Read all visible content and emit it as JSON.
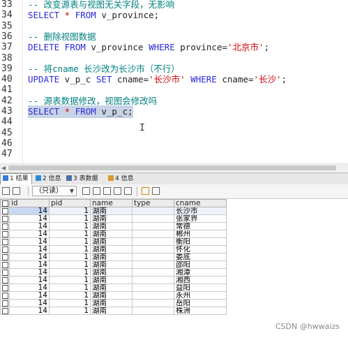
{
  "editor": {
    "lines": [
      {
        "num": "33",
        "parts": [
          {
            "t": "-- 改变源表与视图无关字段，无影响",
            "c": "cmt"
          }
        ]
      },
      {
        "num": "34",
        "parts": [
          {
            "t": "SELECT",
            "c": "kw"
          },
          {
            "t": " * ",
            "c": "str"
          },
          {
            "t": "FROM",
            "c": "kw"
          },
          {
            "t": " v_province;",
            "c": "txt"
          }
        ]
      },
      {
        "num": "35",
        "parts": []
      },
      {
        "num": "36",
        "parts": [
          {
            "t": "-- 删除视图数据",
            "c": "cmt"
          }
        ]
      },
      {
        "num": "37",
        "parts": [
          {
            "t": "DELETE FROM",
            "c": "kw"
          },
          {
            "t": " v_province ",
            "c": "txt"
          },
          {
            "t": "WHERE",
            "c": "kw"
          },
          {
            "t": " province=",
            "c": "txt"
          },
          {
            "t": "'北京市'",
            "c": "str"
          },
          {
            "t": ";",
            "c": "txt"
          }
        ]
      },
      {
        "num": "38",
        "parts": []
      },
      {
        "num": "39",
        "parts": [
          {
            "t": "-- 将cname 长沙改为长沙市（不行）",
            "c": "cmt"
          }
        ]
      },
      {
        "num": "40",
        "parts": [
          {
            "t": "UPDATE",
            "c": "kw"
          },
          {
            "t": " v_p_c ",
            "c": "txt"
          },
          {
            "t": "SET",
            "c": "kw"
          },
          {
            "t": " cname=",
            "c": "txt"
          },
          {
            "t": "'长沙市'",
            "c": "str"
          },
          {
            "t": " ",
            "c": "txt"
          },
          {
            "t": "WHERE",
            "c": "kw"
          },
          {
            "t": " cname=",
            "c": "txt"
          },
          {
            "t": "'长沙'",
            "c": "str"
          },
          {
            "t": ";",
            "c": "txt"
          }
        ]
      },
      {
        "num": "41",
        "parts": []
      },
      {
        "num": "42",
        "parts": [
          {
            "t": "-- 源表数据修改，视图会修改吗",
            "c": "cmt"
          }
        ]
      },
      {
        "num": "43",
        "selected": true,
        "parts": [
          {
            "t": "SELECT",
            "c": "kw"
          },
          {
            "t": " * ",
            "c": "str"
          },
          {
            "t": "FROM",
            "c": "kw"
          },
          {
            "t": " v_p_c;",
            "c": "txt"
          }
        ]
      },
      {
        "num": "44",
        "parts": []
      },
      {
        "num": "45",
        "parts": []
      },
      {
        "num": "46",
        "parts": []
      },
      {
        "num": "47",
        "parts": []
      }
    ],
    "cursor_glyph": "I"
  },
  "tabs": [
    {
      "label": "1 结果",
      "active": true,
      "icon": "result-grid-icon",
      "color": "#3a7bd5"
    },
    {
      "label": "2 信息",
      "active": false,
      "icon": "info-icon",
      "color": "#2e8bd8"
    },
    {
      "label": "3 表数据",
      "active": false,
      "icon": "table-data-icon",
      "color": "#4a6fa5"
    },
    {
      "label": "4 信息",
      "active": false,
      "icon": "info-icon",
      "color": "#d89a2e"
    }
  ],
  "toolbar": {
    "mode_select": "（只读）"
  },
  "grid": {
    "columns": [
      "id",
      "pid",
      "name",
      "type",
      "cname"
    ],
    "rows": [
      [
        "14",
        "1",
        "湖南",
        "",
        "长沙市"
      ],
      [
        "14",
        "1",
        "湖南",
        "",
        "张家界"
      ],
      [
        "14",
        "1",
        "湖南",
        "",
        "常德"
      ],
      [
        "14",
        "1",
        "湖南",
        "",
        "郴州"
      ],
      [
        "14",
        "1",
        "湖南",
        "",
        "衡阳"
      ],
      [
        "14",
        "1",
        "湖南",
        "",
        "怀化"
      ],
      [
        "14",
        "1",
        "湖南",
        "",
        "娄底"
      ],
      [
        "14",
        "1",
        "湖南",
        "",
        "邵阳"
      ],
      [
        "14",
        "1",
        "湖南",
        "",
        "湘潭"
      ],
      [
        "14",
        "1",
        "湖南",
        "",
        "湘西"
      ],
      [
        "14",
        "1",
        "湖南",
        "",
        "益阳"
      ],
      [
        "14",
        "1",
        "湖南",
        "",
        "永州"
      ],
      [
        "14",
        "1",
        "湖南",
        "",
        "岳阳"
      ],
      [
        "14",
        "1",
        "湖南",
        "",
        "株洲"
      ]
    ]
  },
  "watermark": "CSDN @hwwaizs"
}
